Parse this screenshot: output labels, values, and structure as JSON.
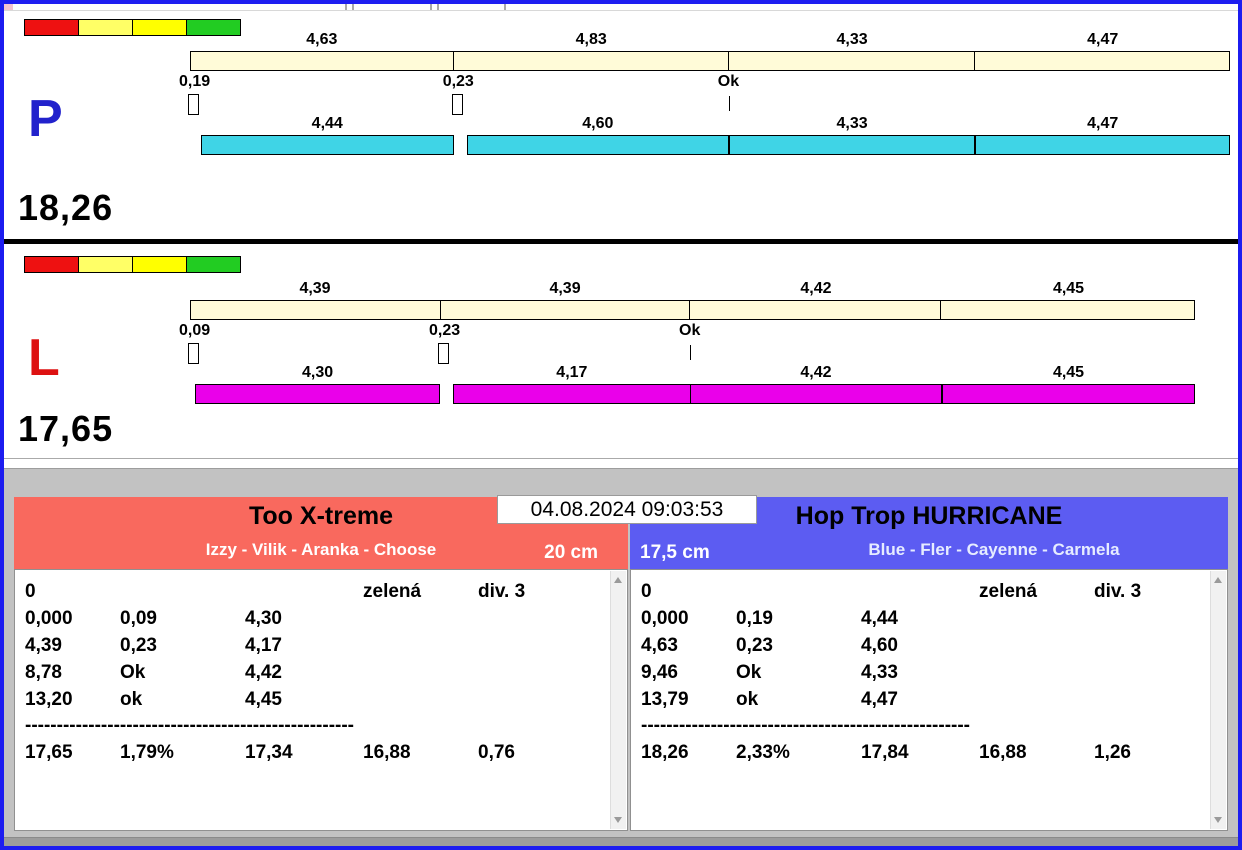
{
  "window": {
    "border_color": "#1c1cf0"
  },
  "traffic_colors": [
    "#ee1111",
    "#ffff66",
    "#ffff00",
    "#22cc22"
  ],
  "panels": [
    {
      "letter": "P",
      "letter_color": "#2222cc",
      "total": "18,26",
      "split_bar_color": "#fffbd8",
      "bar_color": "#3fd4e6",
      "legs": [
        {
          "split": "4,63",
          "dog": "4,44"
        },
        {
          "split": "4,83",
          "dog": "4,60"
        },
        {
          "split": "4,33",
          "dog": "4,33"
        },
        {
          "split": "4,47",
          "dog": "4,47"
        }
      ],
      "markers": [
        {
          "label": "0,19",
          "kind": "box"
        },
        {
          "label": "0,23",
          "kind": "box"
        },
        {
          "label": "Ok",
          "kind": "tick"
        }
      ]
    },
    {
      "letter": "L",
      "letter_color": "#dd1111",
      "total": "17,65",
      "split_bar_color": "#fffbd8",
      "bar_color": "#ea00ea",
      "legs": [
        {
          "split": "4,39",
          "dog": "4,30"
        },
        {
          "split": "4,39",
          "dog": "4,17"
        },
        {
          "split": "4,42",
          "dog": "4,42"
        },
        {
          "split": "4,45",
          "dog": "4,45"
        }
      ],
      "markers": [
        {
          "label": "0,09",
          "kind": "box"
        },
        {
          "label": "0,23",
          "kind": "box"
        },
        {
          "label": "Ok",
          "kind": "tick"
        }
      ]
    }
  ],
  "footer": {
    "datetime": "04.08.2024 09:03:53",
    "left": {
      "title": "Too X-treme",
      "subtitle": "Izzy - Vilik - Aranka - Choose",
      "height_label": "20 cm",
      "header_color": "#f9695e",
      "rows": [
        [
          "0",
          "",
          "",
          "zelená",
          "div. 3"
        ],
        [
          "0,000",
          "0,09",
          "4,30",
          "",
          ""
        ],
        [
          "4,39",
          "0,23",
          "4,17",
          "",
          ""
        ],
        [
          "8,78",
          "Ok",
          "4,42",
          "",
          ""
        ],
        [
          "13,20",
          "ok",
          "4,45",
          "",
          ""
        ]
      ],
      "separator": "----------------------------------------------------",
      "total_row": [
        "17,65",
        "1,79%",
        "17,34",
        "16,88",
        "0,76"
      ]
    },
    "right": {
      "title": "Hop Trop HURRICANE",
      "subtitle": "Blue - Fler - Cayenne - Carmela",
      "height_label": "17,5 cm",
      "header_color": "#5c5cf2",
      "rows": [
        [
          "0",
          "",
          "",
          "zelená",
          "div. 3"
        ],
        [
          "0,000",
          "0,19",
          "4,44",
          "",
          ""
        ],
        [
          "4,63",
          "0,23",
          "4,60",
          "",
          ""
        ],
        [
          "9,46",
          "Ok",
          "4,33",
          "",
          ""
        ],
        [
          "13,79",
          "ok",
          "4,47",
          "",
          ""
        ]
      ],
      "separator": "----------------------------------------------------",
      "total_row": [
        "18,26",
        "2,33%",
        "17,84",
        "16,88",
        "1,26"
      ]
    }
  }
}
